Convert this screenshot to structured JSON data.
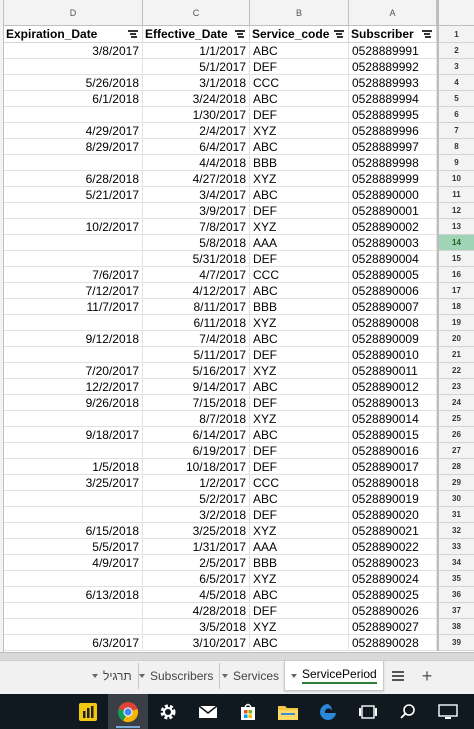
{
  "sheet": {
    "column_letters": [
      "D",
      "C",
      "B",
      "A"
    ],
    "headers": [
      "Expiration_Date",
      "Effective_Date",
      "Service_code",
      "Subscriber"
    ],
    "header_row_number": "1",
    "selected_row_number": "14",
    "rows": [
      {
        "row": "2",
        "exp": "3/8/2017",
        "eff": "1/1/2017",
        "code": "ABC",
        "sub": "0528889991"
      },
      {
        "row": "3",
        "exp": "",
        "eff": "5/1/2017",
        "code": "DEF",
        "sub": "0528889992"
      },
      {
        "row": "4",
        "exp": "5/26/2018",
        "eff": "3/1/2018",
        "code": "CCC",
        "sub": "0528889993"
      },
      {
        "row": "5",
        "exp": "6/1/2018",
        "eff": "3/24/2018",
        "code": "ABC",
        "sub": "0528889994"
      },
      {
        "row": "6",
        "exp": "",
        "eff": "1/30/2017",
        "code": "DEF",
        "sub": "0528889995"
      },
      {
        "row": "7",
        "exp": "4/29/2017",
        "eff": "2/4/2017",
        "code": "XYZ",
        "sub": "0528889996"
      },
      {
        "row": "8",
        "exp": "8/29/2017",
        "eff": "6/4/2017",
        "code": "ABC",
        "sub": "0528889997"
      },
      {
        "row": "9",
        "exp": "",
        "eff": "4/4/2018",
        "code": "BBB",
        "sub": "0528889998"
      },
      {
        "row": "10",
        "exp": "6/28/2018",
        "eff": "4/27/2018",
        "code": "XYZ",
        "sub": "0528889999"
      },
      {
        "row": "11",
        "exp": "5/21/2017",
        "eff": "3/4/2017",
        "code": "ABC",
        "sub": "0528890000"
      },
      {
        "row": "12",
        "exp": "",
        "eff": "3/9/2017",
        "code": "DEF",
        "sub": "0528890001"
      },
      {
        "row": "13",
        "exp": "10/2/2017",
        "eff": "7/8/2017",
        "code": "XYZ",
        "sub": "0528890002"
      },
      {
        "row": "14",
        "exp": "",
        "eff": "5/8/2018",
        "code": "AAA",
        "sub": "0528890003"
      },
      {
        "row": "15",
        "exp": "",
        "eff": "5/31/2018",
        "code": "DEF",
        "sub": "0528890004"
      },
      {
        "row": "16",
        "exp": "7/6/2017",
        "eff": "4/7/2017",
        "code": "CCC",
        "sub": "0528890005"
      },
      {
        "row": "17",
        "exp": "7/12/2017",
        "eff": "4/12/2017",
        "code": "ABC",
        "sub": "0528890006"
      },
      {
        "row": "18",
        "exp": "11/7/2017",
        "eff": "8/11/2017",
        "code": "BBB",
        "sub": "0528890007"
      },
      {
        "row": "19",
        "exp": "",
        "eff": "6/11/2018",
        "code": "XYZ",
        "sub": "0528890008"
      },
      {
        "row": "20",
        "exp": "9/12/2018",
        "eff": "7/4/2018",
        "code": "ABC",
        "sub": "0528890009"
      },
      {
        "row": "21",
        "exp": "",
        "eff": "5/11/2017",
        "code": "DEF",
        "sub": "0528890010"
      },
      {
        "row": "22",
        "exp": "7/20/2017",
        "eff": "5/16/2017",
        "code": "XYZ",
        "sub": "0528890011"
      },
      {
        "row": "23",
        "exp": "12/2/2017",
        "eff": "9/14/2017",
        "code": "ABC",
        "sub": "0528890012"
      },
      {
        "row": "24",
        "exp": "9/26/2018",
        "eff": "7/15/2018",
        "code": "DEF",
        "sub": "0528890013"
      },
      {
        "row": "25",
        "exp": "",
        "eff": "8/7/2018",
        "code": "XYZ",
        "sub": "0528890014"
      },
      {
        "row": "26",
        "exp": "9/18/2017",
        "eff": "6/14/2017",
        "code": "ABC",
        "sub": "0528890015"
      },
      {
        "row": "27",
        "exp": "",
        "eff": "6/19/2017",
        "code": "DEF",
        "sub": "0528890016"
      },
      {
        "row": "28",
        "exp": "1/5/2018",
        "eff": "10/18/2017",
        "code": "DEF",
        "sub": "0528890017"
      },
      {
        "row": "29",
        "exp": "3/25/2017",
        "eff": "1/2/2017",
        "code": "CCC",
        "sub": "0528890018"
      },
      {
        "row": "30",
        "exp": "",
        "eff": "5/2/2017",
        "code": "ABC",
        "sub": "0528890019"
      },
      {
        "row": "31",
        "exp": "",
        "eff": "3/2/2018",
        "code": "DEF",
        "sub": "0528890020"
      },
      {
        "row": "32",
        "exp": "6/15/2018",
        "eff": "3/25/2018",
        "code": "XYZ",
        "sub": "0528890021"
      },
      {
        "row": "33",
        "exp": "5/5/2017",
        "eff": "1/31/2017",
        "code": "AAA",
        "sub": "0528890022"
      },
      {
        "row": "34",
        "exp": "4/9/2017",
        "eff": "2/5/2017",
        "code": "BBB",
        "sub": "0528890023"
      },
      {
        "row": "35",
        "exp": "",
        "eff": "6/5/2017",
        "code": "XYZ",
        "sub": "0528890024"
      },
      {
        "row": "36",
        "exp": "6/13/2018",
        "eff": "4/5/2018",
        "code": "ABC",
        "sub": "0528890025"
      },
      {
        "row": "37",
        "exp": "",
        "eff": "4/28/2018",
        "code": "DEF",
        "sub": "0528890026"
      },
      {
        "row": "38",
        "exp": "",
        "eff": "3/5/2018",
        "code": "XYZ",
        "sub": "0528890027"
      },
      {
        "row": "39",
        "exp": "6/3/2017",
        "eff": "3/10/2017",
        "code": "ABC",
        "sub": "0528890028"
      }
    ]
  },
  "tabs": [
    {
      "label": "תרגיל",
      "active": false
    },
    {
      "label": "Subscribers",
      "active": false
    },
    {
      "label": "Services",
      "active": false
    },
    {
      "label": "ServicePeriod",
      "active": true
    }
  ],
  "taskbar": {
    "apps": [
      "power-bi-icon",
      "chrome-icon",
      "settings-gear-icon",
      "mail-icon",
      "store-icon",
      "file-explorer-icon",
      "edge-icon",
      "task-view-icon",
      "search-icon",
      "desktop-icon"
    ]
  },
  "colors": {
    "selected_row": "#9fd5b6",
    "active_tab_underline": "#2e7d32",
    "taskbar": "#101820"
  }
}
